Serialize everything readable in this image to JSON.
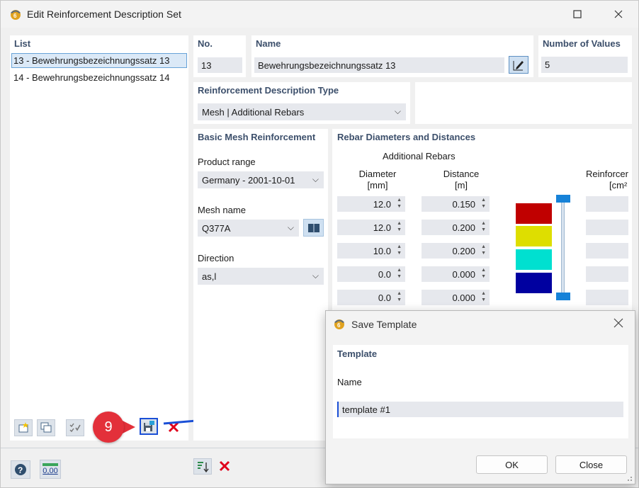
{
  "window": {
    "title": "Edit Reinforcement Description Set"
  },
  "list": {
    "header": "List",
    "items": [
      {
        "label": "13 - Bewehrungsbezeichnungssatz 13",
        "selected": true
      },
      {
        "label": "14 - Bewehrungsbezeichnungssatz 14",
        "selected": false
      }
    ]
  },
  "no": {
    "header": "No.",
    "value": "13"
  },
  "name": {
    "header": "Name",
    "value": "Bewehrungsbezeichnungssatz 13"
  },
  "num_values": {
    "header": "Number of Values",
    "value": "5"
  },
  "desc_type": {
    "header": "Reinforcement Description Type",
    "value": "Mesh | Additional Rebars"
  },
  "basic_mesh": {
    "header": "Basic Mesh Reinforcement",
    "product_range_label": "Product range",
    "product_range_value": "Germany - 2001-10-01",
    "mesh_name_label": "Mesh name",
    "mesh_name_value": "Q377A",
    "direction_label": "Direction",
    "direction_value": "as,l"
  },
  "rebar": {
    "header": "Rebar Diameters and Distances",
    "sub_header": "Additional Rebars",
    "col_diameter": "Diameter",
    "col_diameter_unit": "[mm]",
    "col_distance": "Distance",
    "col_distance_unit": "[m]",
    "col_reinf": "Reinforcer",
    "col_reinf_unit": "[cm²",
    "rows": [
      {
        "diameter": "12.0",
        "distance": "0.150",
        "color": "#c00000"
      },
      {
        "diameter": "12.0",
        "distance": "0.200",
        "color": "#dede00"
      },
      {
        "diameter": "10.0",
        "distance": "0.200",
        "color": "#00e0d0"
      },
      {
        "diameter": "0.0",
        "distance": "0.000",
        "color": "#0000a0"
      },
      {
        "diameter": "0.0",
        "distance": "0.000",
        "color": ""
      }
    ]
  },
  "callout": {
    "number": "9",
    "color": "#e3303a",
    "arrow_color": "#1a4fd6"
  },
  "save_template": {
    "title": "Save Template",
    "section_header": "Template",
    "name_label": "Name",
    "name_value": "template #1",
    "ok_label": "OK",
    "close_label": "Close"
  },
  "bottom": {
    "units_label": "0,00"
  },
  "colors": {
    "accent": "#3c4f6b",
    "field_bg": "#e6e8ed",
    "selection": "#dbe9f7"
  }
}
